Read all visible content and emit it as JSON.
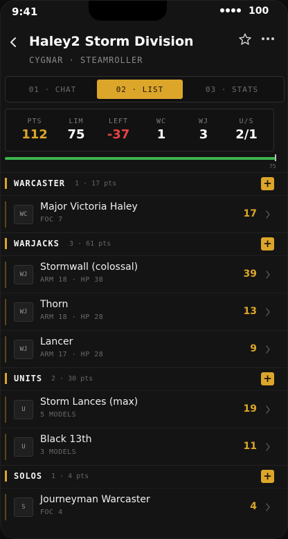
{
  "status": {
    "time": "9:41",
    "battery": "100"
  },
  "header": {
    "title": "Haley2 Storm Division",
    "subtitle": "CYGNAR · STEAMROLLER"
  },
  "tabs": [
    {
      "label": "01 · CHAT"
    },
    {
      "label": "02 · LIST"
    },
    {
      "label": "03 · STATS"
    }
  ],
  "stats": [
    {
      "label": "PTS",
      "value": "112"
    },
    {
      "label": "LIM",
      "value": "75"
    },
    {
      "label": "LEFT",
      "value": "-37"
    },
    {
      "label": "WC",
      "value": "1"
    },
    {
      "label": "WJ",
      "value": "3"
    },
    {
      "label": "U/S",
      "value": "2/1"
    }
  ],
  "progress": {
    "fill_fraction": 1.0,
    "cap_label": "75"
  },
  "sections": [
    {
      "name": "WARCASTER",
      "meta": "1 · 17 pts",
      "entries": [
        {
          "badge": "WC",
          "name": "Major Victoria Haley",
          "sub": "FOC 7",
          "cost": "17"
        }
      ]
    },
    {
      "name": "WARJACKS",
      "meta": "3 · 61 pts",
      "entries": [
        {
          "badge": "WJ",
          "name": "Stormwall (colossal)",
          "sub": "ARM 18 · HP 38",
          "cost": "39"
        },
        {
          "badge": "WJ",
          "name": "Thorn",
          "sub": "ARM 18 · HP 28",
          "cost": "13"
        },
        {
          "badge": "WJ",
          "name": "Lancer",
          "sub": "ARM 17 · HP 28",
          "cost": "9"
        }
      ]
    },
    {
      "name": "UNITS",
      "meta": "2 · 30 pts",
      "entries": [
        {
          "badge": "U",
          "name": "Storm Lances (max)",
          "sub": "5 MODELS",
          "cost": "19"
        },
        {
          "badge": "U",
          "name": "Black 13th",
          "sub": "3 MODELS",
          "cost": "11"
        }
      ]
    },
    {
      "name": "SOLOS",
      "meta": "1 · 4 pts",
      "entries": [
        {
          "badge": "S",
          "name": "Journeyman Warcaster",
          "sub": "FOC 4",
          "cost": "4"
        }
      ]
    }
  ],
  "colors": {
    "accent": "#dca62a",
    "negative": "#e64343",
    "progress": "#3eb550"
  },
  "icons": {
    "back": "chevron-left-icon",
    "favorite": "star-icon",
    "more": "more-icon",
    "add": "plus-icon",
    "open": "chevron-right-icon"
  }
}
